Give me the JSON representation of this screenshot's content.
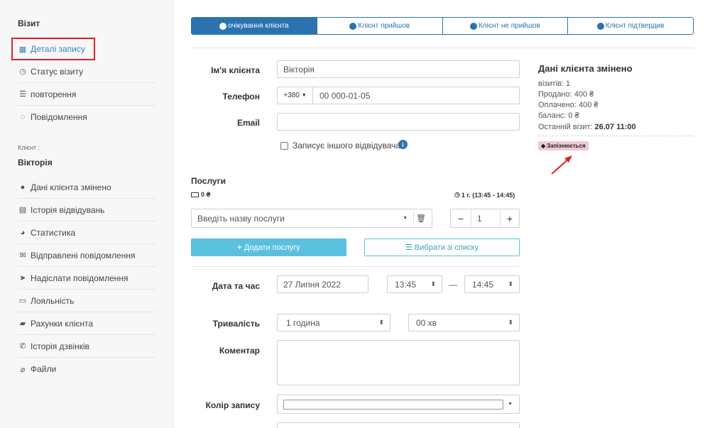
{
  "sidebar": {
    "visit_heading": "Візит",
    "visit_items": [
      {
        "label": "Деталі запису",
        "icon": "calendar-icon"
      },
      {
        "label": "Статус візиту",
        "icon": "clock-icon"
      },
      {
        "label": "повторення",
        "icon": "list-icon"
      },
      {
        "label": "Повідомлення",
        "icon": "chat-icon"
      }
    ],
    "client_label": "Клієнт :",
    "client_name": "Вікторія",
    "client_items": [
      {
        "label": "Дані клієнта змінено",
        "icon": "user-icon"
      },
      {
        "label": "Історія відвідувань",
        "icon": "history-icon"
      },
      {
        "label": "Статистика",
        "icon": "pie-chart-icon"
      },
      {
        "label": "Відправлені повідомлення",
        "icon": "envelope-icon"
      },
      {
        "label": "Надіслати повідомлення",
        "icon": "send-icon"
      },
      {
        "label": "Лояльність",
        "icon": "card-icon"
      },
      {
        "label": "Рахунки клієнта",
        "icon": "briefcase-icon"
      },
      {
        "label": "Історія дзвінків",
        "icon": "phone-icon"
      },
      {
        "label": "Файли",
        "icon": "paperclip-icon"
      }
    ]
  },
  "tabs": [
    {
      "label": "очікування клієнта",
      "active": true
    },
    {
      "label": "Клієнт прийшов",
      "active": false
    },
    {
      "label": "Клієнт не прийшов",
      "active": false
    },
    {
      "label": "Клієнт підтвердив",
      "active": false
    }
  ],
  "form": {
    "name_label": "Ім'я клієнта",
    "name_value": "Вікторія",
    "phone_label": "Телефон",
    "phone_code": "+380",
    "phone_value": "00 000-01-05",
    "email_label": "Email",
    "email_value": "",
    "other_visitor_label": "Записує іншого відвідувача",
    "services_heading": "Послуги",
    "services_total": "0 ₴",
    "services_duration": "1 г. (13:45 - 14:45)",
    "service_placeholder": "Введіть назву послуги",
    "quantity": "1",
    "add_service_label": "Додати послугу",
    "choose_list_label": "Вибрати зі списку",
    "datetime_label": "Дата та час",
    "date_value": "27 Липня 2022",
    "time_start": "13:45",
    "time_end": "14:45",
    "time_separator": "—",
    "duration_label": "Тривалість",
    "duration_hours": "1 година",
    "duration_minutes": "00 хв",
    "comment_label": "Коментар",
    "comment_value": "",
    "color_label": "Колір запису"
  },
  "client_info": {
    "title": "Дані клієнта змінено",
    "visits": "візитів: 1",
    "sold": "Продано: 400 ₴",
    "paid": "Оплачено: 400 ₴",
    "balance": "баланс: 0 ₴",
    "last_visit_label": "Останній візит: ",
    "last_visit_value": "26.07 11:00",
    "badge": "Запізнюється",
    "badge_color": "#f2c9d6"
  },
  "colors": {
    "accent": "#2a73b0",
    "info": "#5bc0de",
    "highlight": "#d9232e",
    "arrow": "#e02020"
  }
}
